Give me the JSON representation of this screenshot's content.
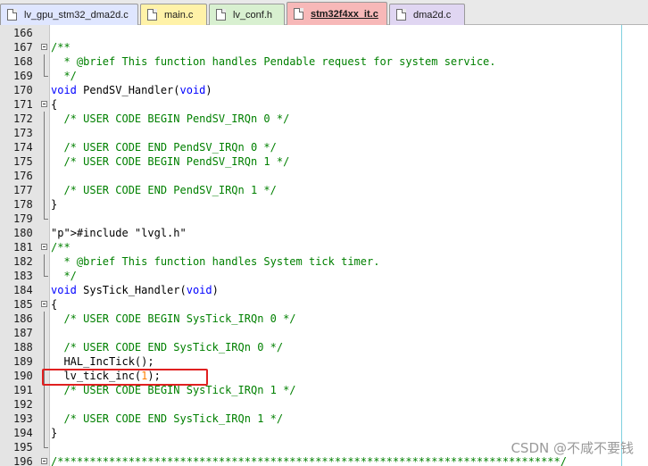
{
  "tabs": [
    {
      "label": "lv_gpu_stm32_dma2d.c",
      "active": false,
      "color": "#dfe6ff"
    },
    {
      "label": "main.c",
      "active": false,
      "color": "#fff2a8"
    },
    {
      "label": "lv_conf.h",
      "active": false,
      "color": "#d8f0d0"
    },
    {
      "label": "stm32f4xx_it.c",
      "active": true,
      "color": "#f7b8b8"
    },
    {
      "label": "dma2d.c",
      "active": false,
      "color": "#e0d6f2"
    }
  ],
  "lines": [
    {
      "num": "166",
      "fold": "none",
      "text": ""
    },
    {
      "num": "167",
      "fold": "box",
      "text": "/**"
    },
    {
      "num": "168",
      "fold": "vline",
      "text": "  * @brief This function handles Pendable request for system service."
    },
    {
      "num": "169",
      "fold": "end",
      "text": "  */"
    },
    {
      "num": "170",
      "fold": "none",
      "text": "void PendSV_Handler(void)"
    },
    {
      "num": "171",
      "fold": "box",
      "text": "{"
    },
    {
      "num": "172",
      "fold": "vline",
      "text": "  /* USER CODE BEGIN PendSV_IRQn 0 */"
    },
    {
      "num": "173",
      "fold": "vline",
      "text": ""
    },
    {
      "num": "174",
      "fold": "vline",
      "text": "  /* USER CODE END PendSV_IRQn 0 */"
    },
    {
      "num": "175",
      "fold": "vline",
      "text": "  /* USER CODE BEGIN PendSV_IRQn 1 */"
    },
    {
      "num": "176",
      "fold": "vline",
      "text": ""
    },
    {
      "num": "177",
      "fold": "vline",
      "text": "  /* USER CODE END PendSV_IRQn 1 */"
    },
    {
      "num": "178",
      "fold": "vline",
      "text": "}"
    },
    {
      "num": "179",
      "fold": "end",
      "text": ""
    },
    {
      "num": "180",
      "fold": "none",
      "text": "#include \"lvgl.h\""
    },
    {
      "num": "181",
      "fold": "box",
      "text": "/**"
    },
    {
      "num": "182",
      "fold": "vline",
      "text": "  * @brief This function handles System tick timer."
    },
    {
      "num": "183",
      "fold": "end",
      "text": "  */"
    },
    {
      "num": "184",
      "fold": "none",
      "text": "void SysTick_Handler(void)"
    },
    {
      "num": "185",
      "fold": "box",
      "text": "{"
    },
    {
      "num": "186",
      "fold": "vline",
      "text": "  /* USER CODE BEGIN SysTick_IRQn 0 */"
    },
    {
      "num": "187",
      "fold": "vline",
      "text": ""
    },
    {
      "num": "188",
      "fold": "vline",
      "text": "  /* USER CODE END SysTick_IRQn 0 */"
    },
    {
      "num": "189",
      "fold": "vline",
      "text": "  HAL_IncTick();"
    },
    {
      "num": "190",
      "fold": "vline",
      "text": "  lv_tick_inc(1);"
    },
    {
      "num": "191",
      "fold": "vline",
      "text": "  /* USER CODE BEGIN SysTick_IRQn 1 */"
    },
    {
      "num": "192",
      "fold": "vline",
      "text": ""
    },
    {
      "num": "193",
      "fold": "vline",
      "text": "  /* USER CODE END SysTick_IRQn 1 */"
    },
    {
      "num": "194",
      "fold": "vline",
      "text": "}"
    },
    {
      "num": "195",
      "fold": "end",
      "text": ""
    },
    {
      "num": "196",
      "fold": "box",
      "text": "/******************************************************************************/"
    }
  ],
  "watermark": "CSDN @不咸不要钱",
  "colors": {
    "comment": "#008000",
    "keyword": "#0000ff",
    "preprocessor": "#804000",
    "string": "#808080",
    "number": "#ff8000",
    "highlight_box": "#e02020"
  }
}
